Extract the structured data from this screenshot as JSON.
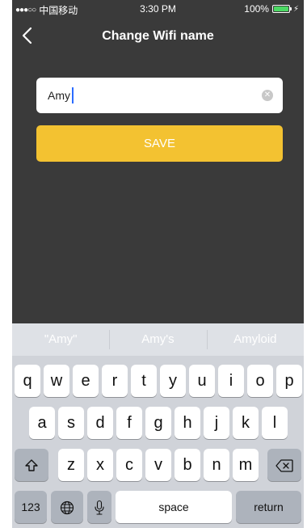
{
  "status_bar": {
    "signal_dots": "●●●○○",
    "carrier": "中国移动",
    "time": "3:30 PM",
    "battery": "100%"
  },
  "nav": {
    "title": "Change Wifi name"
  },
  "form": {
    "value": "Amy",
    "save_label": "SAVE"
  },
  "keyboard": {
    "suggestions": [
      "\"Amy\"",
      "Amy's",
      "Amyloid"
    ],
    "row1": [
      "q",
      "w",
      "e",
      "r",
      "t",
      "y",
      "u",
      "i",
      "o",
      "p"
    ],
    "row2": [
      "a",
      "s",
      "d",
      "f",
      "g",
      "h",
      "j",
      "k",
      "l"
    ],
    "row3": [
      "z",
      "x",
      "c",
      "v",
      "b",
      "n",
      "m"
    ],
    "numbers_label": "123",
    "space_label": "space",
    "return_label": "return"
  },
  "colors": {
    "background": "#3a3a3a",
    "accent": "#f3c231"
  },
  "icons": [
    "back-chevron-icon",
    "clear-icon",
    "shift-icon",
    "backspace-icon",
    "globe-icon",
    "microphone-icon",
    "battery-icon",
    "bolt-icon"
  ]
}
